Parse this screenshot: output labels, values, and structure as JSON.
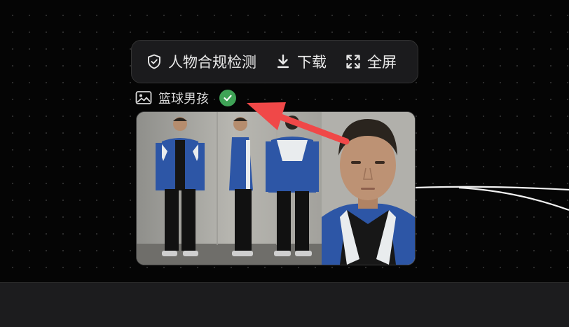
{
  "toolbar": {
    "compliance_label": "人物合规检测",
    "download_label": "下载",
    "fullscreen_label": "全屏"
  },
  "node": {
    "title": "篮球男孩",
    "status": "verified",
    "status_color": "#3fa356"
  },
  "image": {
    "description_icon": "image-icon",
    "views": [
      "front",
      "side",
      "back",
      "face-closeup"
    ]
  },
  "annotation": {
    "arrow_color": "#f04848"
  },
  "colors": {
    "canvas_bg": "#050505",
    "toolbar_bg": "#1b1b1d",
    "jacket_blue": "#2d56a6"
  }
}
